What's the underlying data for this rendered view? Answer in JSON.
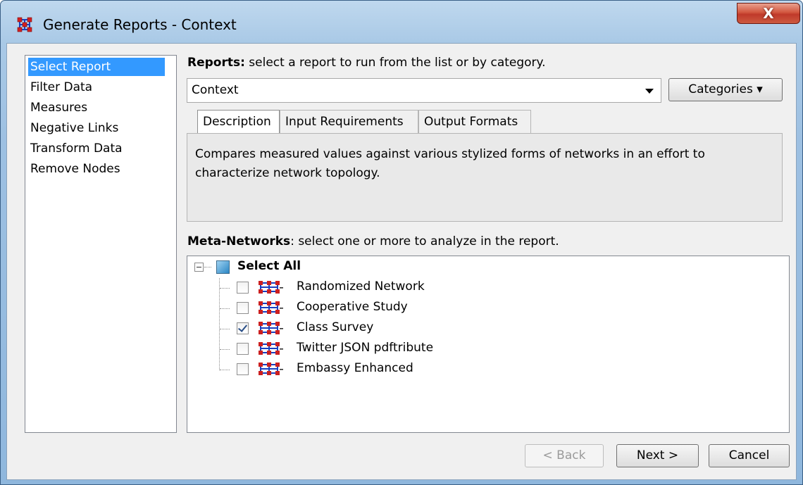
{
  "window": {
    "title": "Generate Reports - Context",
    "close_symbol": "X"
  },
  "nav": {
    "items": [
      {
        "label": "Select Report",
        "selected": true
      },
      {
        "label": "Filter Data",
        "selected": false
      },
      {
        "label": "Measures",
        "selected": false
      },
      {
        "label": "Negative Links",
        "selected": false
      },
      {
        "label": "Transform Data",
        "selected": false
      },
      {
        "label": "Remove Nodes",
        "selected": false
      }
    ]
  },
  "reports": {
    "heading_bold": "Reports:",
    "heading_rest": " select a report to run from the list or by category.",
    "selected_value": "Context",
    "categories_button": "Categories ▾"
  },
  "tabs": [
    {
      "label": "Description",
      "active": true
    },
    {
      "label": "Input Requirements",
      "active": false
    },
    {
      "label": "Output Formats",
      "active": false
    }
  ],
  "description": "Compares measured values against various stylized forms of networks in an effort to characterize network topology.",
  "meta_networks": {
    "heading_bold": "Meta-Networks",
    "heading_rest": ": select one or more to analyze in the report.",
    "select_all": "Select All",
    "items": [
      {
        "label": "Randomized Network",
        "checked": false
      },
      {
        "label": "Cooperative Study",
        "checked": false
      },
      {
        "label": "Class Survey",
        "checked": true
      },
      {
        "label": "Twitter JSON pdftribute",
        "checked": false
      },
      {
        "label": "Embassy Enhanced",
        "checked": false
      }
    ]
  },
  "buttons": {
    "back": "< Back",
    "next": "Next >",
    "cancel": "Cancel"
  },
  "colors": {
    "selection": "#3399ff",
    "title_bar": "#a9c9e6",
    "close_button": "#c0392a",
    "network_icon_node": "#cc1f1f",
    "network_icon_link": "#1a3fbf"
  },
  "icons": {
    "app": "network-app-icon",
    "tree_node": "meta-network-icon",
    "expander": "collapse-minus-icon"
  }
}
